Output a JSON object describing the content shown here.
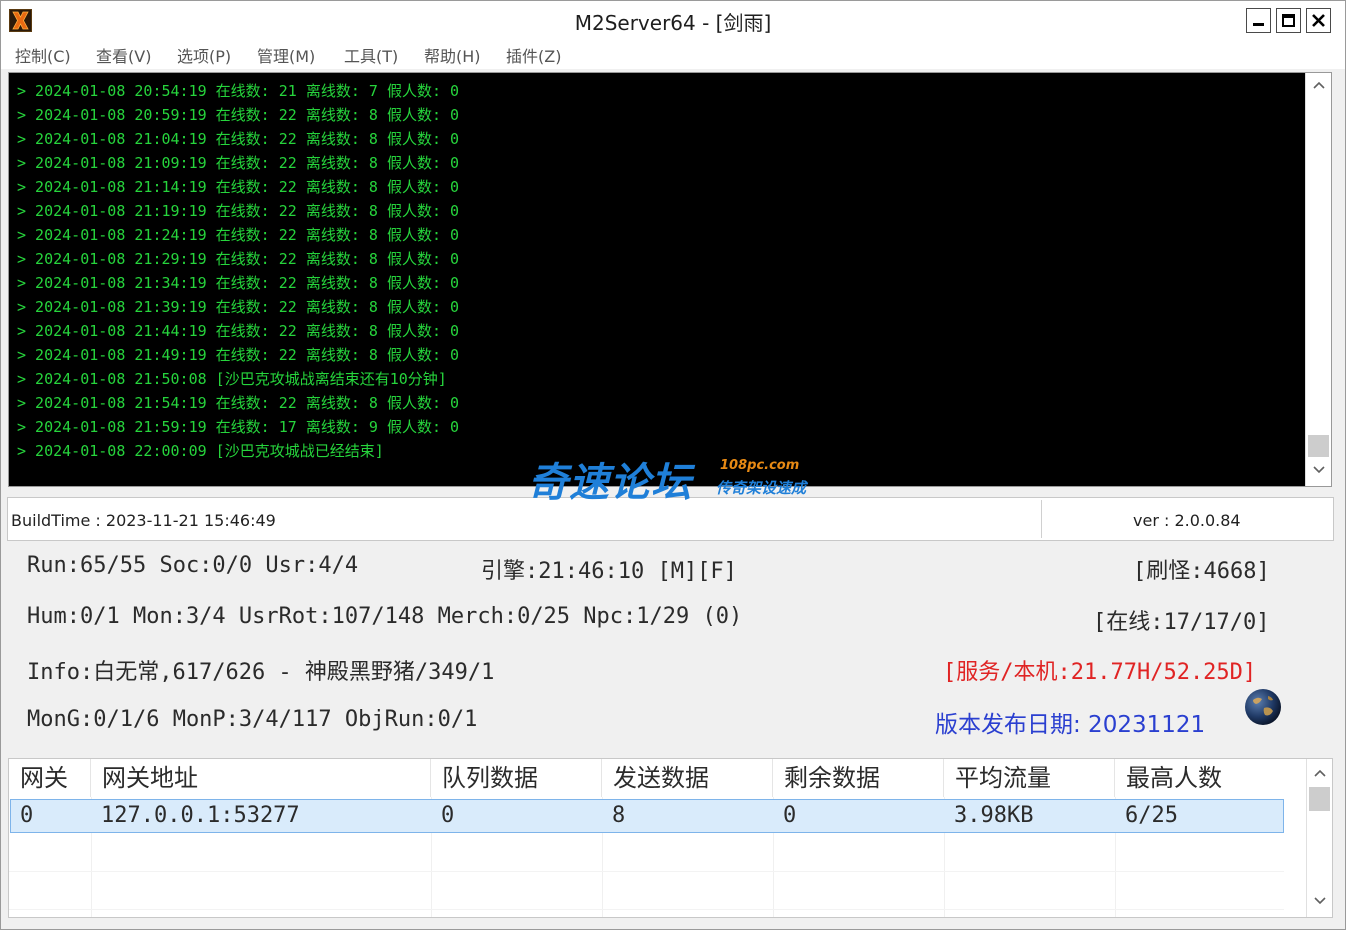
{
  "window": {
    "title": "M2Server64 - [剑雨]",
    "icons": {
      "app": "x-logo-icon",
      "minimize": "minimize-icon",
      "maximize": "maximize-icon",
      "close": "close-icon"
    }
  },
  "menu": {
    "items": [
      {
        "label": "控制(C)"
      },
      {
        "label": "查看(V)"
      },
      {
        "label": "选项(P)"
      },
      {
        "label": "管理(M)"
      },
      {
        "label": "工具(T)"
      },
      {
        "label": "帮助(H)"
      },
      {
        "label": "插件(Z)"
      }
    ]
  },
  "console": {
    "text_color": "#26d43c",
    "background": "#000000",
    "lines": [
      "> 2024-01-08 20:54:19 在线数: 21 离线数: 7 假人数: 0",
      "> 2024-01-08 20:59:19 在线数: 22 离线数: 8 假人数: 0",
      "> 2024-01-08 21:04:19 在线数: 22 离线数: 8 假人数: 0",
      "> 2024-01-08 21:09:19 在线数: 22 离线数: 8 假人数: 0",
      "> 2024-01-08 21:14:19 在线数: 22 离线数: 8 假人数: 0",
      "> 2024-01-08 21:19:19 在线数: 22 离线数: 8 假人数: 0",
      "> 2024-01-08 21:24:19 在线数: 22 离线数: 8 假人数: 0",
      "> 2024-01-08 21:29:19 在线数: 22 离线数: 8 假人数: 0",
      "> 2024-01-08 21:34:19 在线数: 22 离线数: 8 假人数: 0",
      "> 2024-01-08 21:39:19 在线数: 22 离线数: 8 假人数: 0",
      "> 2024-01-08 21:44:19 在线数: 22 离线数: 8 假人数: 0",
      "> 2024-01-08 21:49:19 在线数: 22 离线数: 8 假人数: 0",
      "> 2024-01-08 21:50:08 [沙巴克攻城战离结束还有10分钟]",
      "> 2024-01-08 21:54:19 在线数: 22 离线数: 8 假人数: 0",
      "> 2024-01-08 21:59:19 在线数: 17 离线数: 9 假人数: 0",
      "> 2024-01-08 22:00:09 [沙巴克攻城战已经结束]"
    ]
  },
  "watermark": {
    "main": "奇速论坛",
    "url": "108pc.com",
    "sub": "传奇架设速成"
  },
  "status": {
    "build_time": "BuildTime : 2023-11-21 15:46:49",
    "version": "ver : 2.0.0.84"
  },
  "info": {
    "run": "Run:65/55 Soc:0/0 Usr:4/4",
    "engine": "引擎:21:46:10 [M][F]",
    "refresh": "[刷怪:4668]",
    "hum": "Hum:0/1 Mon:3/4 UsrRot:107/148 Merch:0/25 Npc:1/29 (0)",
    "online": "[在线:17/17/0]",
    "info_line": "Info:白无常,617/626 - 神殿黑野猪/349/1",
    "service": "[服务/本机:21.77H/52.25D]",
    "mong": "MonG:0/1/6 MonP:3/4/117 ObjRun:0/1",
    "release_date": "版本发布日期: 20231121",
    "globe_icon": "globe-icon",
    "colors": {
      "service": "#e02424",
      "release": "#2a3fd0"
    }
  },
  "gateway_table": {
    "columns": [
      "网关",
      "网关地址",
      "队列数据",
      "发送数据",
      "剩余数据",
      "平均流量",
      "最高人数"
    ],
    "rows": [
      [
        "0",
        "127.0.0.1:53277",
        "0",
        "8",
        "0",
        "3.98KB",
        "6/25"
      ]
    ],
    "selected_row_color": "#d9ebfb"
  }
}
